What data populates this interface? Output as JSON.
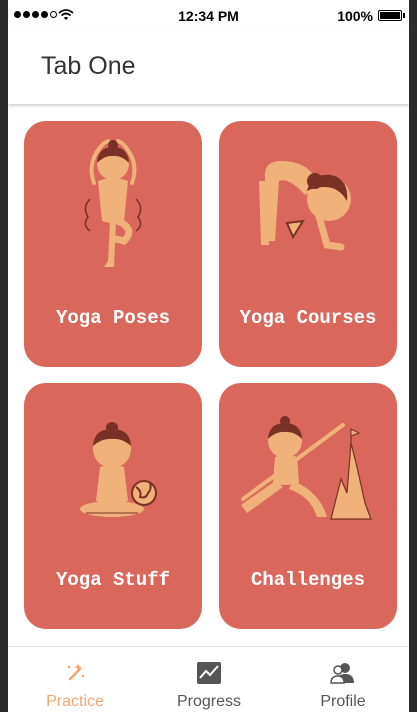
{
  "status_bar": {
    "time": "12:34 PM",
    "battery": "100%",
    "battery_level": 1.0,
    "signal_bars_filled": 4,
    "signal_bars_total": 5
  },
  "header": {
    "title": "Tab One"
  },
  "cards": [
    {
      "label": "Yoga Poses",
      "illustration": "tree-pose-icon"
    },
    {
      "label": "Yoga Courses",
      "illustration": "forward-bend-icon"
    },
    {
      "label": "Yoga Stuff",
      "illustration": "meditation-globe-icon"
    },
    {
      "label": "Challenges",
      "illustration": "warrior-mountain-icon"
    }
  ],
  "tabs": [
    {
      "label": "Practice",
      "icon": "magic-wand-icon",
      "active": true
    },
    {
      "label": "Progress",
      "icon": "chart-icon",
      "active": false
    },
    {
      "label": "Profile",
      "icon": "users-icon",
      "active": false
    }
  ],
  "colors": {
    "card": "#d9675b",
    "figure": "#f0b17a",
    "hair": "#7a3024",
    "active_tab": "#f0a574",
    "inactive_tab": "#555555"
  }
}
